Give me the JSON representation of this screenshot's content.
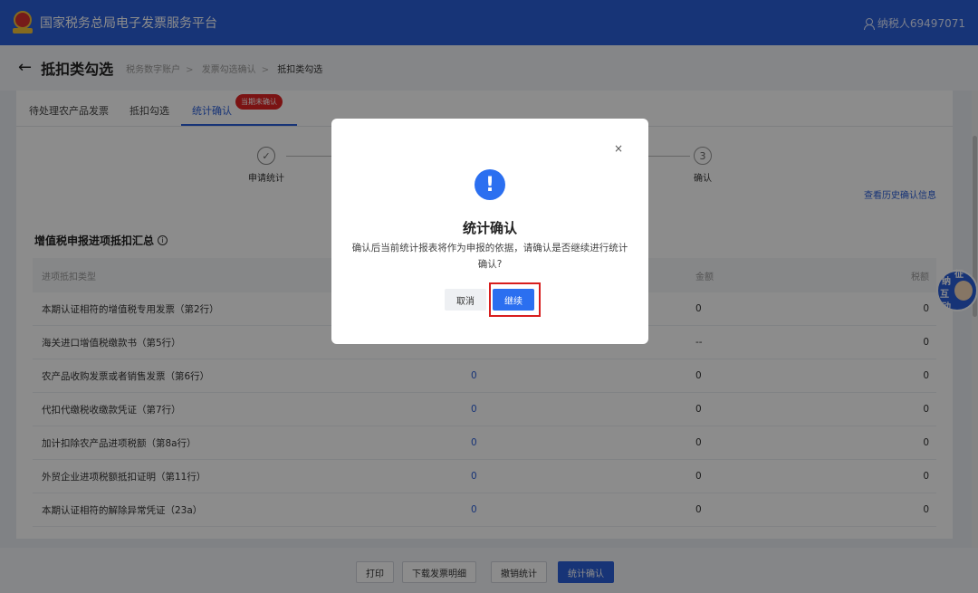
{
  "topbar": {
    "brand": "国家税务总局电子发票服务平台",
    "user": "纳税人69497071"
  },
  "header": {
    "title": "抵扣类勾选",
    "breadcrumb": [
      "税务数字账户",
      "发票勾选确认",
      "抵扣类勾选"
    ]
  },
  "tabs": [
    {
      "label": "待处理农产品发票"
    },
    {
      "label": "抵扣勾选"
    },
    {
      "label": "统计确认",
      "active": true
    }
  ],
  "tab_badge": "当期未确认",
  "steps": [
    {
      "label": "申请统计",
      "icon": "check-icon"
    },
    {
      "number": "3",
      "label": "确认"
    }
  ],
  "history_link": "查看历史确认信息",
  "section_title": "增值税申报进项抵扣汇总",
  "table": {
    "headers": [
      "进项抵扣类型",
      "",
      "金额",
      "税额"
    ],
    "rows": [
      {
        "type": "本期认证相符的增值税专用发票（第2行）",
        "count": "",
        "amount": "0",
        "tax": "0"
      },
      {
        "type": "海关进口增值税缴款书（第5行）",
        "count": "",
        "amount": "--",
        "tax": "0"
      },
      {
        "type": "农产品收购发票或者销售发票（第6行）",
        "count": "0",
        "amount": "0",
        "tax": "0"
      },
      {
        "type": "代扣代缴税收缴款凭证（第7行）",
        "count": "0",
        "amount": "0",
        "tax": "0"
      },
      {
        "type": "加计扣除农产品进项税额（第8a行）",
        "count": "0",
        "amount": "0",
        "tax": "0"
      },
      {
        "type": "外贸企业进项税额抵扣证明（第11行）",
        "count": "0",
        "amount": "0",
        "tax": "0"
      },
      {
        "type": "本期认证相符的解除异常凭证（23a）",
        "count": "0",
        "amount": "0",
        "tax": "0"
      }
    ]
  },
  "bottom_buttons": [
    "打印",
    "下载发票明细",
    "撤销统计",
    "统计确认"
  ],
  "modal": {
    "close": "×",
    "icon": "!",
    "title": "统计确认",
    "message": "确认后当前统计报表将作为申报的依据，请确认是否继续进行统计确认?",
    "cancel": "取消",
    "continue": "继续"
  },
  "floater": {
    "chars": [
      "征",
      "纳",
      "互",
      "动"
    ]
  },
  "colors": {
    "primary": "#2b5fd9",
    "highlight": "#d81e1e",
    "badge": "#e02424"
  }
}
